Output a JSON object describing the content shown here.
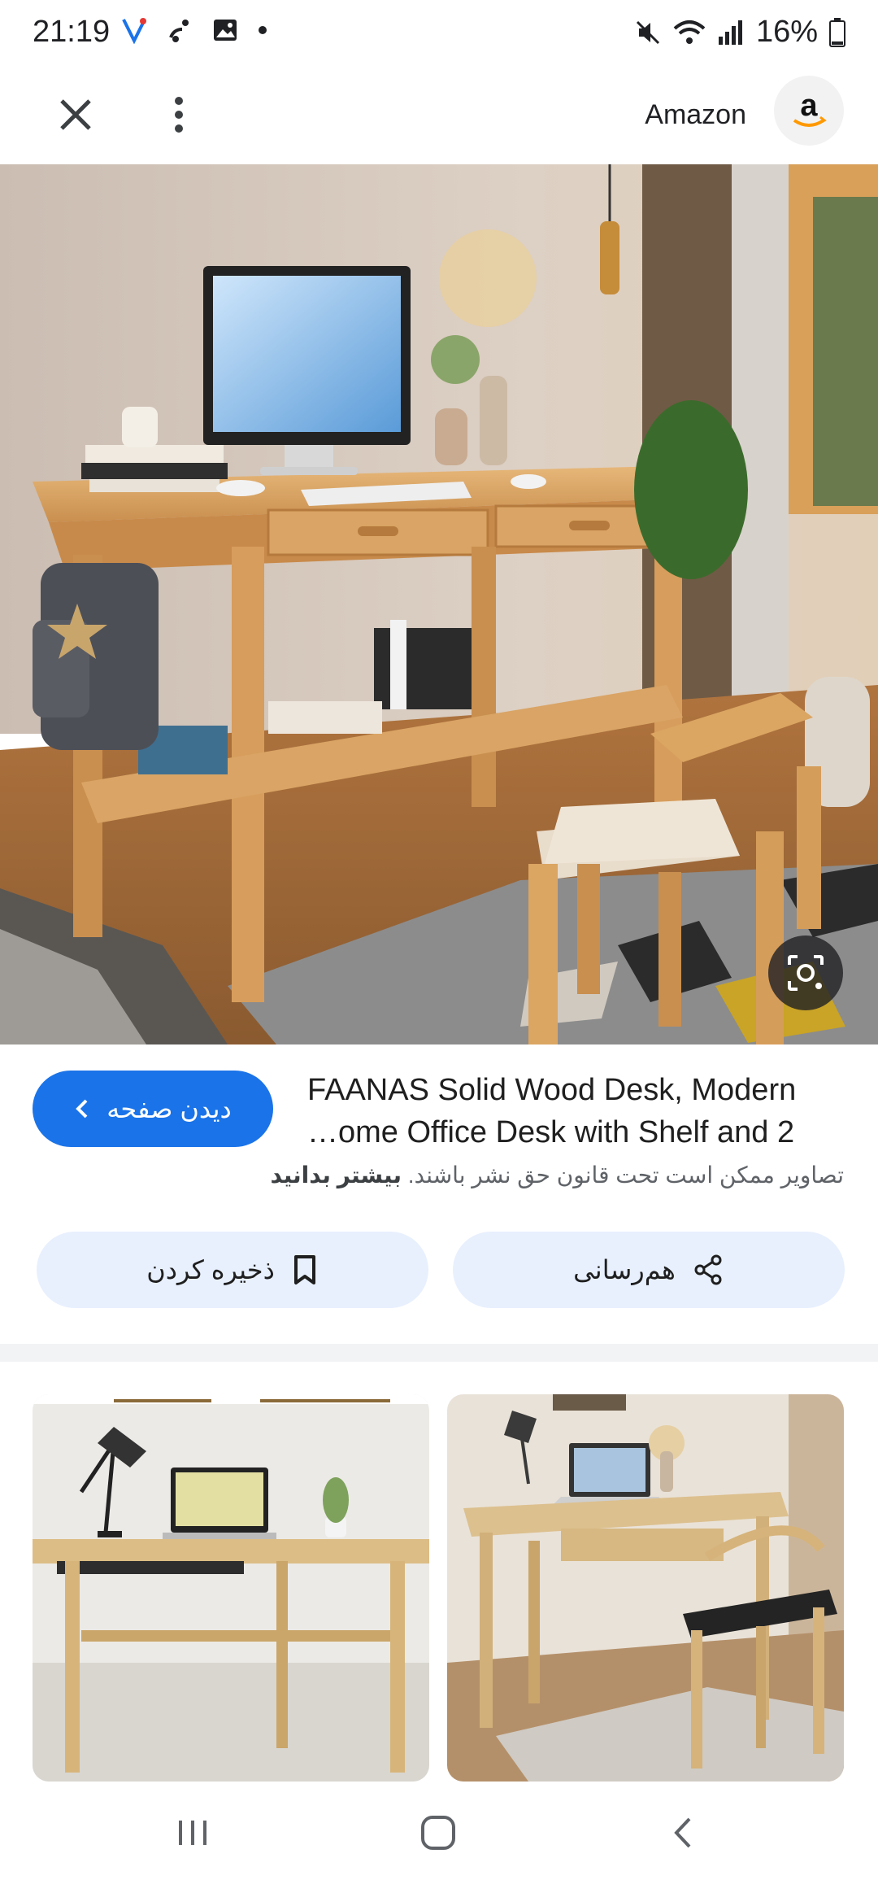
{
  "status_bar": {
    "time": "21:19",
    "battery": "16%",
    "icons": [
      "vpn-icon",
      "missed-call-icon",
      "gallery-icon",
      "dot-icon",
      "mute-icon",
      "wifi-icon",
      "signal-icon",
      "battery-icon"
    ]
  },
  "top_bar": {
    "source_name": "Amazon",
    "icons": [
      "close-icon",
      "more-vert-icon",
      "amazon-logo"
    ]
  },
  "result": {
    "title_line1": "FAANAS Solid Wood Desk, Modern",
    "title_line2": "…ome Office Desk with Shelf and 2",
    "visit_label": "دیدن صفحه",
    "copyright_text": "تصاویر ممکن است تحت قانون حق نشر باشند.",
    "learn_more": "بیشتر بدانید"
  },
  "actions": {
    "share_label": "هم‌رسانی",
    "save_label": "ذخیره کردن"
  },
  "colors": {
    "primary": "#1a73e8",
    "tonal_button": "#e8f0fe",
    "divider": "#f1f3f4"
  }
}
